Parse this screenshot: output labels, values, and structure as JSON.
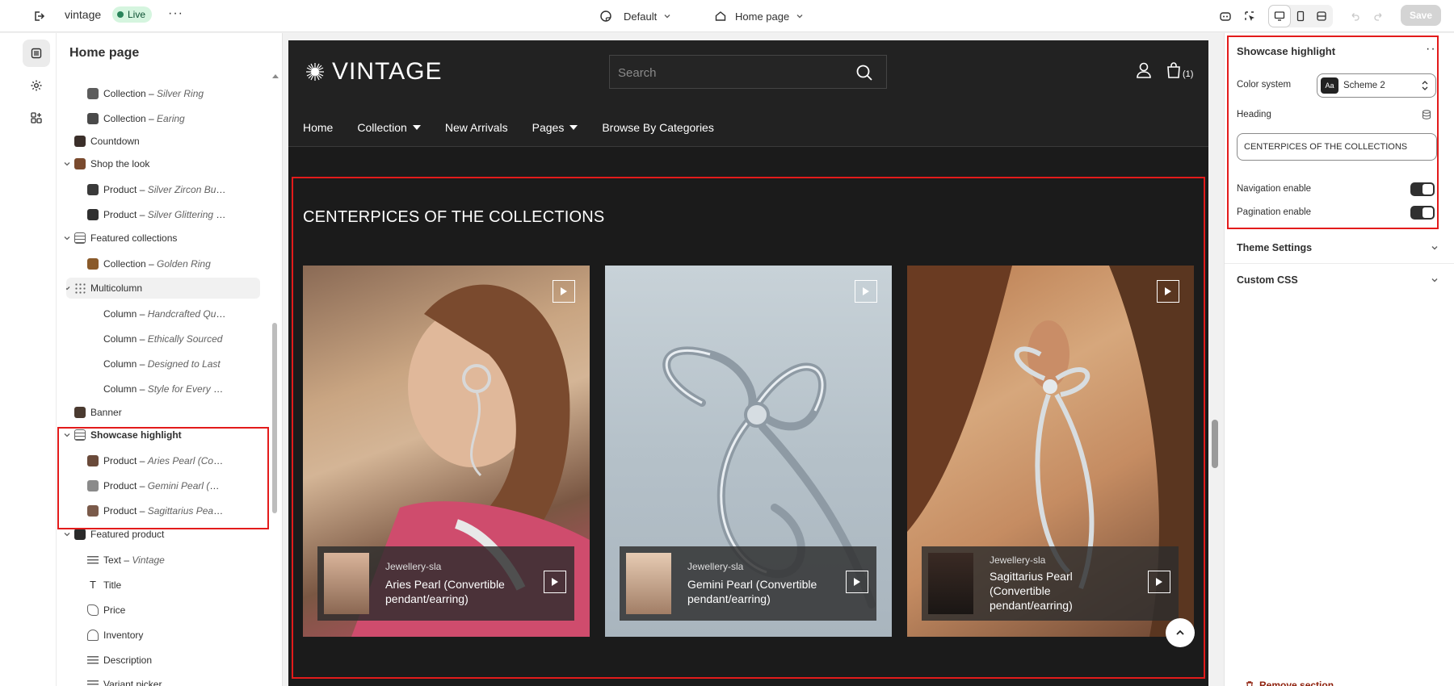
{
  "topbar": {
    "store_name": "vintage",
    "status": "Live",
    "more": "···",
    "theme": "Default",
    "page": "Home page",
    "save": "Save"
  },
  "sidebar": {
    "title": "Home page",
    "items": [
      {
        "type": "Collection",
        "name": "Silver Ring"
      },
      {
        "type": "Collection",
        "name": "Earing"
      },
      {
        "type": "Countdown",
        "name": ""
      },
      {
        "type": "Shop the look",
        "name": ""
      },
      {
        "type": "Product",
        "name": "Silver Zircon Bubble S..."
      },
      {
        "type": "Product",
        "name": "Silver Glittering Ring"
      },
      {
        "type": "Featured collections",
        "name": ""
      },
      {
        "type": "Collection",
        "name": "Golden Ring"
      },
      {
        "type": "Multicolumn",
        "name": ""
      },
      {
        "type": "Column",
        "name": "Handcrafted Quality"
      },
      {
        "type": "Column",
        "name": "Ethically Sourced"
      },
      {
        "type": "Column",
        "name": "Designed to Last"
      },
      {
        "type": "Column",
        "name": "Style for Every Story"
      },
      {
        "type": "Banner",
        "name": ""
      },
      {
        "type": "Showcase highlight",
        "name": ""
      },
      {
        "type": "Product",
        "name": "Aries Pearl (Convertibl..."
      },
      {
        "type": "Product",
        "name": "Gemini Pearl (Converti..."
      },
      {
        "type": "Product",
        "name": "Sagittarius Pearl (Con..."
      },
      {
        "type": "Featured product",
        "name": ""
      },
      {
        "type": "Text",
        "name": "Vintage"
      },
      {
        "type": "Title",
        "name": ""
      },
      {
        "type": "Price",
        "name": ""
      },
      {
        "type": "Inventory",
        "name": ""
      },
      {
        "type": "Description",
        "name": ""
      },
      {
        "type": "Variant picker",
        "name": ""
      }
    ]
  },
  "preview": {
    "logo": "VINTAGE",
    "search_placeholder": "Search",
    "cart_count": "(1)",
    "nav": [
      "Home",
      "Collection",
      "New Arrivals",
      "Pages",
      "Browse By Categories"
    ],
    "section_heading": "CENTERPICES OF THE COLLECTIONS",
    "cards": [
      {
        "brand": "Jewellery-sla",
        "name": "Aries Pearl (Convertible pendant/earring)"
      },
      {
        "brand": "Jewellery-sla",
        "name": "Gemini Pearl (Convertible pendant/earring)"
      },
      {
        "brand": "Jewellery-sla",
        "name": "Sagittarius Pearl (Convertible pendant/earring)"
      }
    ]
  },
  "settings": {
    "title": "Showcase highlight",
    "more": "···",
    "color_system_label": "Color system",
    "color_scheme_swatch": "Aa",
    "color_scheme": "Scheme 2",
    "heading_label": "Heading",
    "heading_value": "CENTERPICES OF THE COLLECTIONS",
    "navigation_label": "Navigation enable",
    "navigation_enabled": true,
    "pagination_label": "Pagination enable",
    "pagination_enabled": true,
    "theme_settings": "Theme Settings",
    "custom_css": "Custom CSS",
    "remove_section": "Remove section"
  },
  "colors": {
    "accent_red": "#e31b1b",
    "live_bg": "#d5f5df",
    "preview_bg": "#1b1b1b"
  }
}
